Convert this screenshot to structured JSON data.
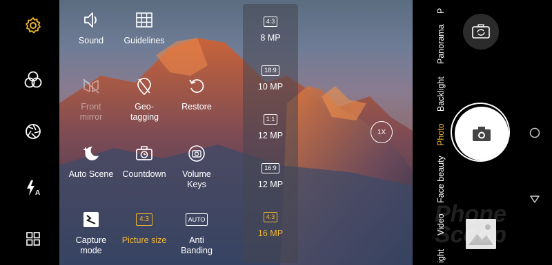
{
  "settings": [
    {
      "label": "Sound",
      "icon": "sound-icon",
      "state": "normal"
    },
    {
      "label": "Guidelines",
      "icon": "grid-icon",
      "state": "normal"
    },
    {
      "label": "Front mirror",
      "icon": "mirror-icon",
      "state": "disabled"
    },
    {
      "label": "Geo-tagging",
      "icon": "geo-tag-off-icon",
      "state": "normal"
    },
    {
      "label": "Restore",
      "icon": "restore-icon",
      "state": "normal"
    },
    {
      "label": "Auto Scene",
      "icon": "auto-scene-icon",
      "state": "normal"
    },
    {
      "label": "Countdown",
      "icon": "timer-camera-icon",
      "state": "normal"
    },
    {
      "label": "Volume Keys",
      "icon": "volume-keys-icon",
      "state": "normal"
    },
    {
      "label": "Capture mode",
      "icon": "capture-mode-icon",
      "state": "normal"
    },
    {
      "label": "Picture size",
      "icon": "picture-size-icon",
      "state": "active",
      "badge": "4:3"
    },
    {
      "label": "Anti Banding",
      "icon": "anti-banding-icon",
      "state": "normal",
      "badge": "AUTO"
    }
  ],
  "resolutions": [
    {
      "ratio": "4:3",
      "size": "8 MP",
      "selected": false
    },
    {
      "ratio": "18:9",
      "size": "10 MP",
      "selected": false
    },
    {
      "ratio": "1:1",
      "size": "12 MP",
      "selected": false
    },
    {
      "ratio": "16:9",
      "size": "12 MP",
      "selected": false
    },
    {
      "ratio": "4:3",
      "size": "16 MP",
      "selected": true
    }
  ],
  "zoom": "1X",
  "modes": [
    "P",
    "Panorama",
    "Backlight",
    "Photo",
    "Face beauty",
    "Video",
    "ight"
  ],
  "active_mode": "Photo",
  "left_rail": [
    "settings-gear-icon",
    "filters-icon",
    "aperture-icon",
    "flash-auto-icon",
    "grid-layout-icon"
  ],
  "watermark": "Phone Scoop",
  "colors": {
    "accent": "#f2b632",
    "panel": "#464650"
  }
}
